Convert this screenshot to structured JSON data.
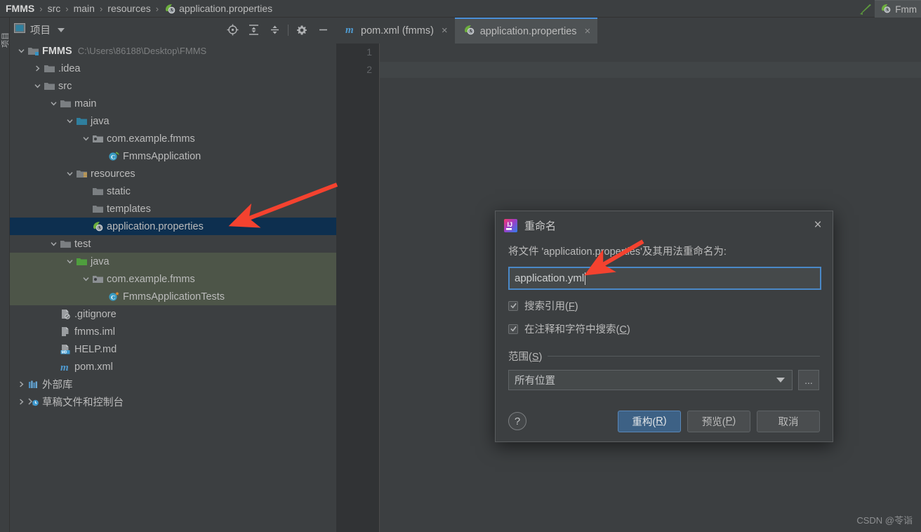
{
  "breadcrumb": {
    "items": [
      "FMMS",
      "src",
      "main",
      "resources",
      "application.properties"
    ],
    "separator": "›"
  },
  "topbar_right": {
    "hammer_icon": "hammer-icon",
    "mini_tab_label": "Fmm"
  },
  "left_stripe": {
    "label": "项目"
  },
  "project_panel": {
    "title": "项目",
    "tools": [
      {
        "name": "locate-icon",
        "tip": "Select Opened File"
      },
      {
        "name": "expand-all-icon",
        "tip": "Expand All"
      },
      {
        "name": "collapse-all-icon",
        "tip": "Collapse All"
      },
      {
        "name": "settings-gear-icon",
        "tip": "Options"
      },
      {
        "name": "hide-panel-icon",
        "tip": "Hide"
      }
    ]
  },
  "tree": {
    "nodes": [
      {
        "label": "FMMS",
        "path": "C:\\Users\\86188\\Desktop\\FMMS",
        "indent": 0,
        "twisty": "expanded",
        "icon": "module-folder-icon",
        "bold": true,
        "state": "normal"
      },
      {
        "label": ".idea",
        "path": "",
        "indent": 1,
        "twisty": "collapsed",
        "icon": "folder-icon",
        "bold": false,
        "state": "normal"
      },
      {
        "label": "src",
        "path": "",
        "indent": 1,
        "twisty": "expanded",
        "icon": "folder-icon",
        "bold": false,
        "state": "normal"
      },
      {
        "label": "main",
        "path": "",
        "indent": 2,
        "twisty": "expanded",
        "icon": "folder-icon",
        "bold": false,
        "state": "normal"
      },
      {
        "label": "java",
        "path": "",
        "indent": 3,
        "twisty": "expanded",
        "icon": "source-folder-icon",
        "bold": false,
        "state": "normal"
      },
      {
        "label": "com.example.fmms",
        "path": "",
        "indent": 4,
        "twisty": "expanded",
        "icon": "package-icon",
        "bold": false,
        "state": "normal"
      },
      {
        "label": "FmmsApplication",
        "path": "",
        "indent": 5,
        "twisty": "none",
        "icon": "spring-class-icon",
        "bold": false,
        "state": "normal"
      },
      {
        "label": "resources",
        "path": "",
        "indent": 3,
        "twisty": "expanded",
        "icon": "resources-folder-icon",
        "bold": false,
        "state": "normal"
      },
      {
        "label": "static",
        "path": "",
        "indent": 4,
        "twisty": "none",
        "icon": "folder-icon",
        "bold": false,
        "state": "normal"
      },
      {
        "label": "templates",
        "path": "",
        "indent": 4,
        "twisty": "none",
        "icon": "folder-icon",
        "bold": false,
        "state": "normal"
      },
      {
        "label": "application.properties",
        "path": "",
        "indent": 4,
        "twisty": "none",
        "icon": "spring-config-icon",
        "bold": false,
        "state": "selected"
      },
      {
        "label": "test",
        "path": "",
        "indent": 2,
        "twisty": "expanded",
        "icon": "folder-icon",
        "bold": false,
        "state": "normal"
      },
      {
        "label": "java",
        "path": "",
        "indent": 3,
        "twisty": "expanded",
        "icon": "test-source-folder-icon",
        "bold": false,
        "state": "highlighted"
      },
      {
        "label": "com.example.fmms",
        "path": "",
        "indent": 4,
        "twisty": "expanded",
        "icon": "package-icon",
        "bold": false,
        "state": "highlighted"
      },
      {
        "label": "FmmsApplicationTests",
        "path": "",
        "indent": 5,
        "twisty": "none",
        "icon": "test-class-icon",
        "bold": false,
        "state": "highlighted"
      },
      {
        "label": ".gitignore",
        "path": "",
        "indent": 2,
        "twisty": "none",
        "icon": "gitignore-file-icon",
        "bold": false,
        "state": "normal"
      },
      {
        "label": "fmms.iml",
        "path": "",
        "indent": 2,
        "twisty": "none",
        "icon": "iml-file-icon",
        "bold": false,
        "state": "normal"
      },
      {
        "label": "HELP.md",
        "path": "",
        "indent": 2,
        "twisty": "none",
        "icon": "markdown-file-icon",
        "bold": false,
        "state": "normal"
      },
      {
        "label": "pom.xml",
        "path": "",
        "indent": 2,
        "twisty": "none",
        "icon": "maven-file-icon",
        "bold": false,
        "state": "normal"
      },
      {
        "label": "外部库",
        "path": "",
        "indent": 0,
        "twisty": "collapsed",
        "icon": "external-libraries-icon",
        "bold": false,
        "state": "normal"
      },
      {
        "label": "草稿文件和控制台",
        "path": "",
        "indent": 0,
        "twisty": "collapsed",
        "icon": "scratches-console-icon",
        "bold": false,
        "state": "normal"
      }
    ]
  },
  "editor": {
    "tabs": [
      {
        "label": "pom.xml (fmms)",
        "icon": "maven-file-icon",
        "active": false,
        "close": "×"
      },
      {
        "label": "application.properties",
        "icon": "spring-config-icon",
        "active": true,
        "close": "×"
      }
    ],
    "line_numbers": [
      "1",
      "2"
    ],
    "current_line": 2
  },
  "dialog": {
    "logo": "intellij-idea-logo-icon",
    "title": "重命名",
    "close_label": "×",
    "prompt": "将文件 'application.properties'及其用法重命名为:",
    "input_value": "application.yml",
    "input_placeholder": "",
    "checkboxes": [
      {
        "label": "搜索引用(",
        "mnemonic": "F",
        "label_tail": ")",
        "checked": true
      },
      {
        "label": "在注释和字符中搜索(",
        "mnemonic": "C",
        "label_tail": ")",
        "checked": true
      }
    ],
    "scope_label": "范围(",
    "scope_mnemonic": "S",
    "scope_label_tail": ")",
    "scope_value": "所有位置",
    "ellipsis_label": "...",
    "help_label": "?",
    "buttons": [
      {
        "label": "重构(",
        "mnemonic": "R",
        "label_tail": ")",
        "style": "primary",
        "name": "refactor-button"
      },
      {
        "label": "预览(",
        "mnemonic": "P",
        "label_tail": ")",
        "style": "secondary",
        "name": "preview-button"
      },
      {
        "label": "取消",
        "mnemonic": "",
        "label_tail": "",
        "style": "secondary",
        "name": "cancel-button"
      }
    ]
  },
  "watermark": "CSDN @苓诣",
  "colors": {
    "panel_bg": "#3c3f41",
    "editor_bg": "#2b2b2b",
    "selection_blue": "#0d2f4f",
    "test_highlight_green": "#4d5548",
    "accent_blue": "#4a88c7",
    "primary_button": "#3d6185",
    "annotation_red": "#f44336",
    "text": "#bbbbbb"
  }
}
